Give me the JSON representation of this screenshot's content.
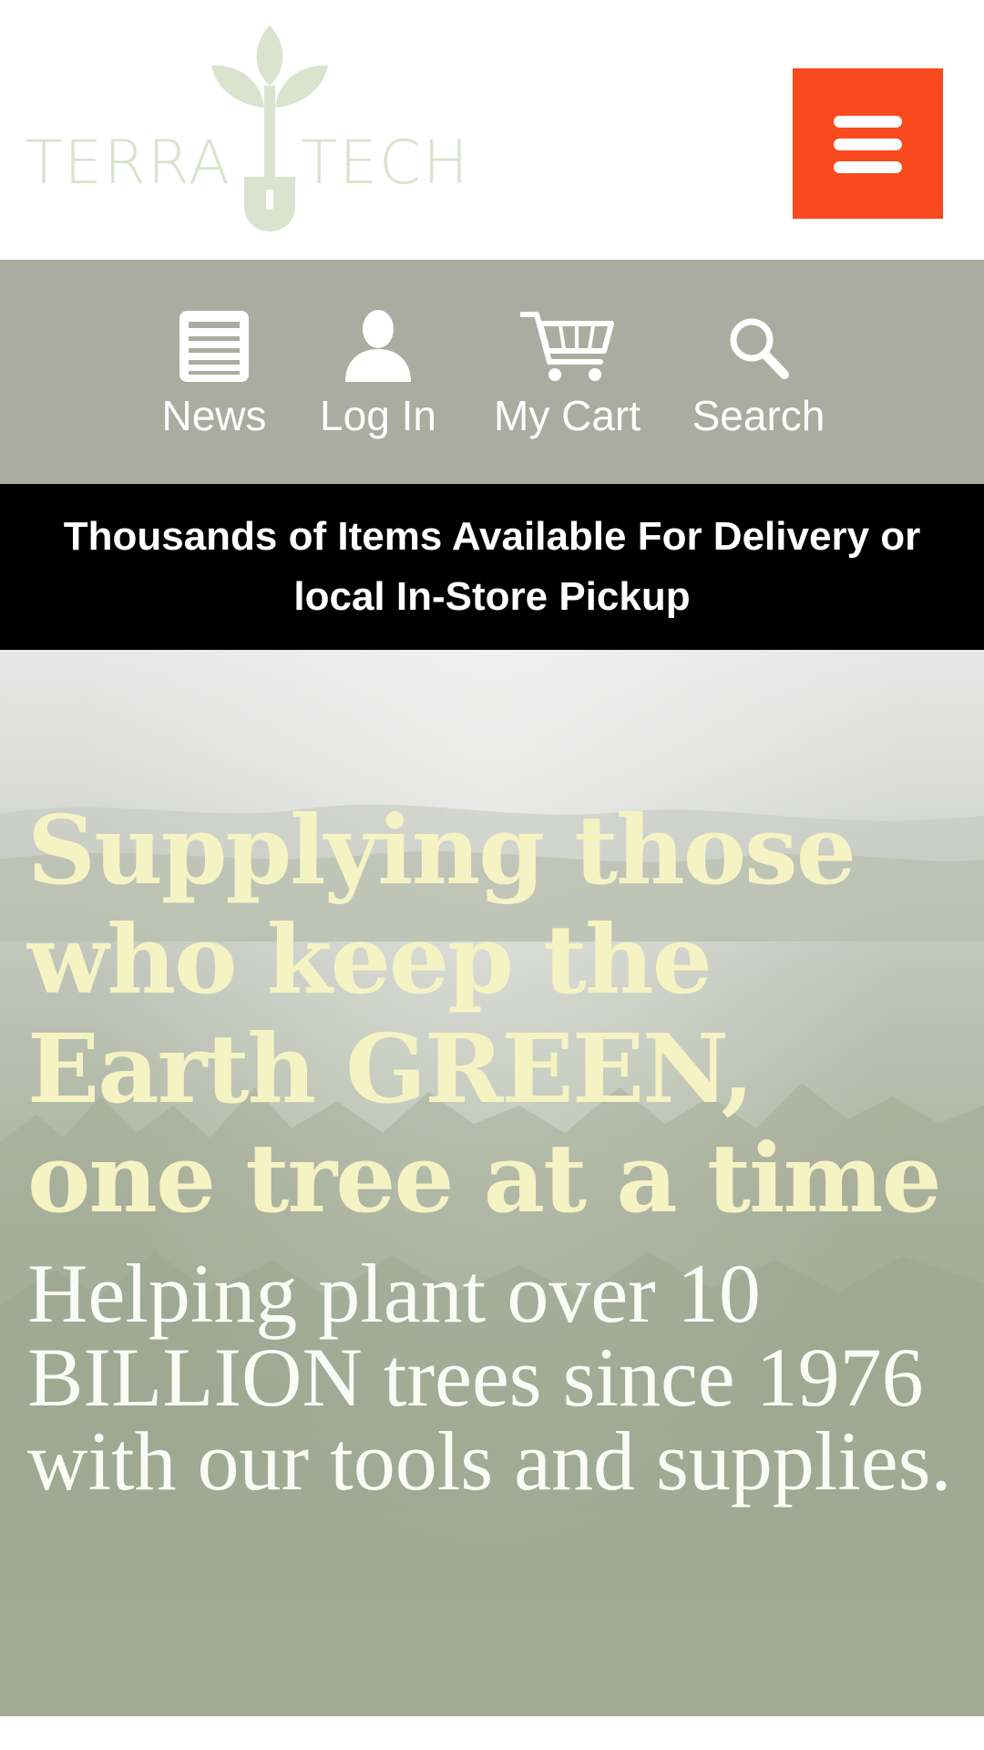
{
  "brand": {
    "word_left": "TERRA",
    "word_right": "TECH",
    "logo_color": "#d9e3cd"
  },
  "header": {
    "menu_icon": "hamburger-menu-icon",
    "menu_color": "#f84a1e"
  },
  "util_nav": {
    "background": "#abaca0",
    "items": [
      {
        "label": "News",
        "icon": "newspaper-icon"
      },
      {
        "label": "Log In",
        "icon": "user-icon"
      },
      {
        "label": "My Cart",
        "icon": "cart-icon"
      },
      {
        "label": "Search",
        "icon": "search-icon"
      }
    ]
  },
  "promo": {
    "text": "Thousands of Items Available For Delivery or local In-Store Pickup"
  },
  "hero": {
    "title": "Supplying those who keep the Earth GREEN, one tree at a time",
    "subtitle": "Helping plant over 10 BILLION trees since 1976 with our tools and supplies.",
    "title_color": "#f5f2c4"
  }
}
